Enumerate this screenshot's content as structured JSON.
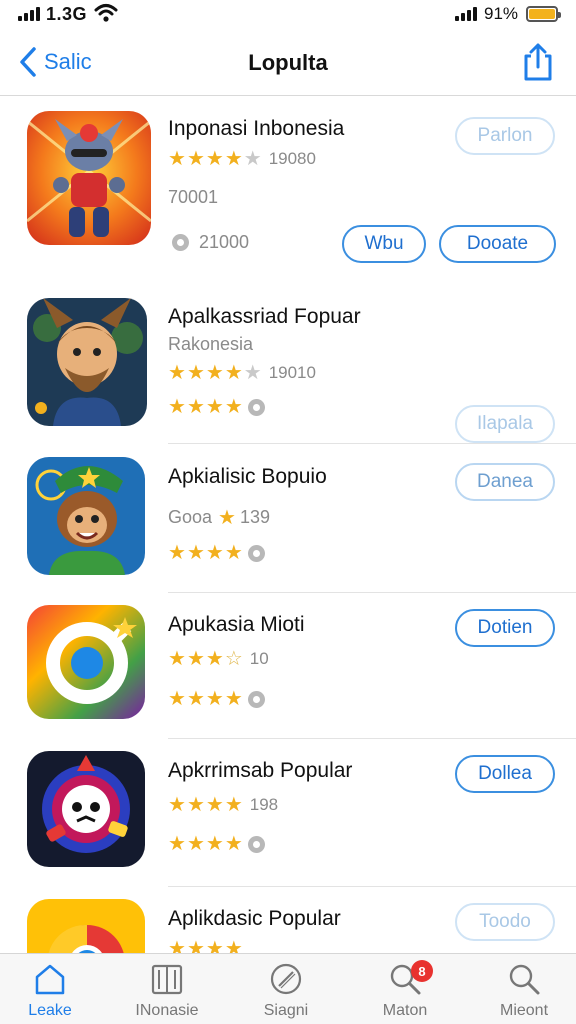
{
  "status_bar": {
    "carrier": "1.3G",
    "battery_percent": "91%",
    "battery_color": "#f3b21c"
  },
  "nav": {
    "back_label": "Salic",
    "title": "Lopulta",
    "share_icon": "share-icon"
  },
  "apps": [
    {
      "name": "Inponasi Inbonesia",
      "rating_stars": 4.5,
      "rating_count": "19080",
      "subtitle": "70001",
      "meta_value": "21000",
      "buttons": [
        "Wbu",
        "Dooate"
      ],
      "top_button": "Parlon"
    },
    {
      "name": "Apalkassriad Fopuar",
      "subtitle": "Rakonesia",
      "rating_stars": 4.5,
      "rating_count": "19010",
      "second_rating_stars": 4,
      "top_button": "Ilapala"
    },
    {
      "name": "Apkialisic Bopuio",
      "subtitle": "Gooа",
      "subtitle_rating": "139",
      "rating_stars": 4,
      "top_button": "Danea"
    },
    {
      "name": "Apukasia Mioti",
      "rating_stars": 3.5,
      "rating_count": "10",
      "second_rating_stars": 4,
      "top_button": "Dotien"
    },
    {
      "name": "Apkrrimsab Popular",
      "rating_stars": 4,
      "rating_count": "198",
      "second_rating_stars": 4,
      "top_button": "Dollea"
    },
    {
      "name": "Aplikdasic Popular",
      "rating_stars": 4,
      "top_button": "Toodo"
    }
  ],
  "tabs": [
    {
      "label": "Leake",
      "icon": "home-icon",
      "active": true
    },
    {
      "label": "INonasie",
      "icon": "book-icon"
    },
    {
      "label": "Siagni",
      "icon": "compass-icon"
    },
    {
      "label": "Maton",
      "icon": "search-icon",
      "badge": "8"
    },
    {
      "label": "Mieont",
      "icon": "search-icon"
    }
  ],
  "colors": {
    "accent": "#1f7ee8",
    "star": "#f2b01e",
    "badge": "#e8322f"
  }
}
